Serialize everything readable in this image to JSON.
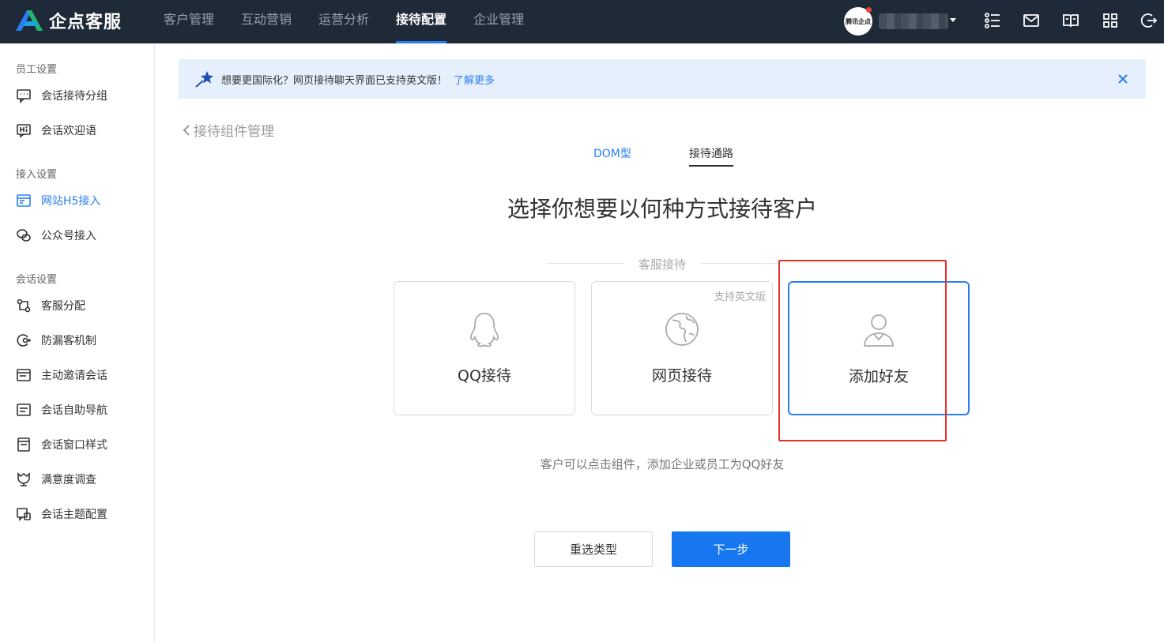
{
  "header": {
    "logo_text": "企点客服",
    "nav": [
      "客户管理",
      "互动营销",
      "运营分析",
      "接待配置",
      "企业管理"
    ],
    "active_nav": "接待配置",
    "avatar_text": "腾讯企点",
    "icons": [
      "tasks-icon",
      "mail-icon",
      "book-icon",
      "apps-icon",
      "logout-icon"
    ]
  },
  "sidebar": {
    "groups": [
      {
        "title": "员工设置",
        "items": [
          "会话接待分组",
          "会话欢迎语"
        ]
      },
      {
        "title": "接入设置",
        "items": [
          "网站H5接入",
          "公众号接入"
        ]
      },
      {
        "title": "会话设置",
        "items": [
          "客服分配",
          "防漏客机制",
          "主动邀请会话",
          "会话自助导航",
          "会话窗口样式",
          "满意度调查",
          "会话主题配置"
        ]
      }
    ],
    "active_item": "网站H5接入"
  },
  "notice": {
    "text": "想要更国际化？网页接待聊天界面已支持英文版！",
    "link": "了解更多"
  },
  "main": {
    "back_label": "接待组件管理",
    "tabs": [
      "DOM型",
      "接待通路"
    ],
    "active_tab": "接待通路",
    "heading": "选择你想要以何种方式接待客户",
    "section_label": "客服接待",
    "cards": [
      {
        "label": "QQ接待",
        "icon": "qq-penguin-icon",
        "tag": ""
      },
      {
        "label": "网页接待",
        "icon": "globe-icon",
        "tag": "支持英文版"
      },
      {
        "label": "添加好友",
        "icon": "user-icon",
        "tag": ""
      }
    ],
    "selected_card": "添加好友",
    "hint": "客户可以点击组件，添加企业或员工为QQ好友",
    "buttons": {
      "reselect": "重选类型",
      "next": "下一步"
    }
  },
  "colors": {
    "topbar": "#1f2a38",
    "accent": "#2a7ef0",
    "highlight": "#e4302b",
    "notice_bg": "#e6f0fc"
  }
}
